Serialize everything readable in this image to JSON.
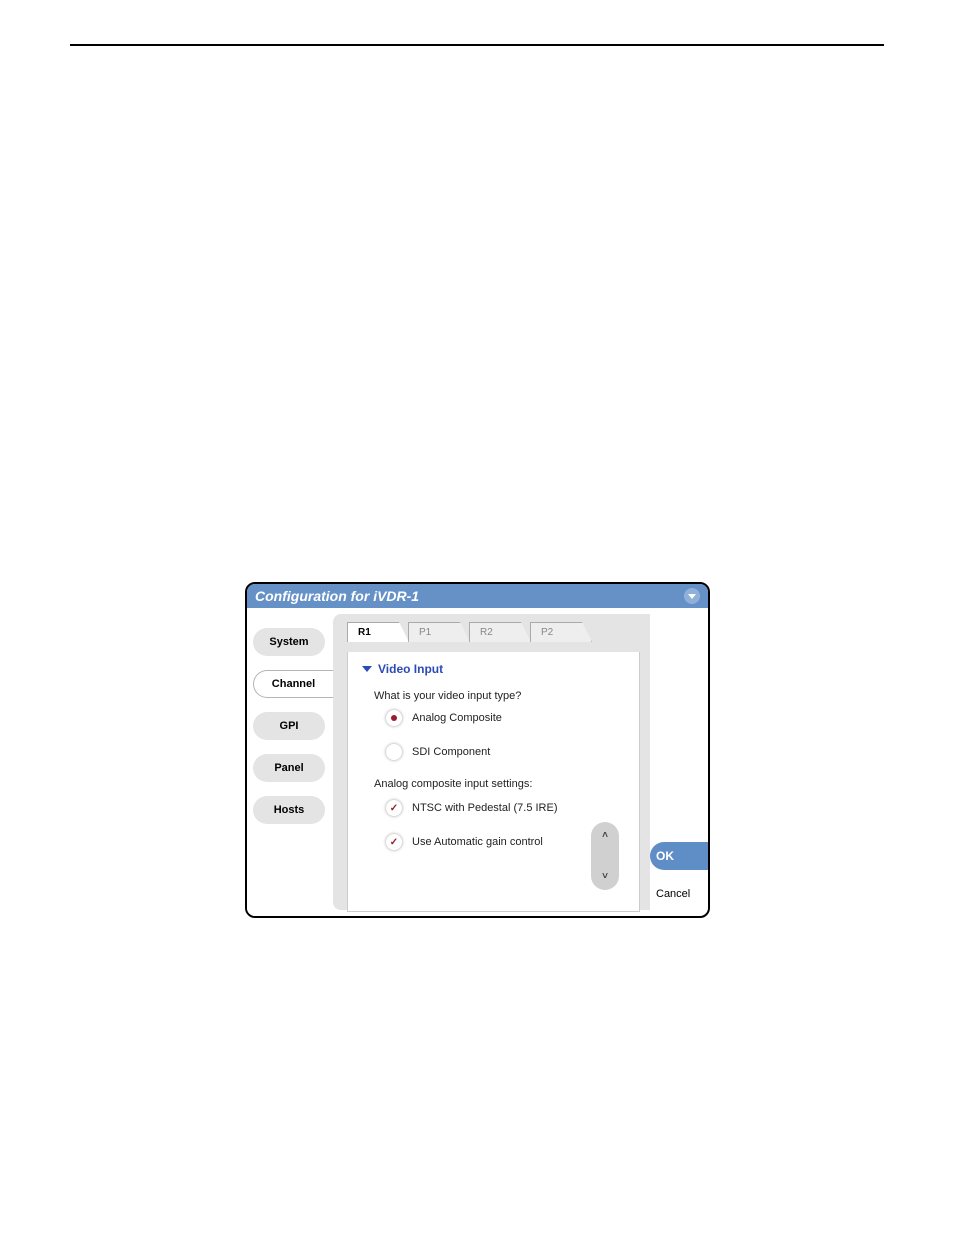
{
  "titlebar": {
    "title": "Configuration for iVDR-1"
  },
  "sidebar": {
    "items": [
      {
        "label": "System"
      },
      {
        "label": "Channel"
      },
      {
        "label": "GPI"
      },
      {
        "label": "Panel"
      },
      {
        "label": "Hosts"
      }
    ],
    "selected_index": 1
  },
  "tabs": {
    "items": [
      {
        "label": "R1"
      },
      {
        "label": "P1"
      },
      {
        "label": "R2"
      },
      {
        "label": "P2"
      }
    ],
    "active_index": 0
  },
  "panel": {
    "section_title": "Video Input",
    "question": "What is your video input type?",
    "radio_options": [
      {
        "label": "Analog Composite",
        "selected": true
      },
      {
        "label": "SDI Component",
        "selected": false
      }
    ],
    "settings_heading": "Analog composite input settings:",
    "check_options": [
      {
        "label": "NTSC with Pedestal (7.5 IRE)",
        "checked": true
      },
      {
        "label": "Use Automatic gain control",
        "checked": true
      }
    ]
  },
  "actions": {
    "ok": "OK",
    "cancel": "Cancel"
  }
}
